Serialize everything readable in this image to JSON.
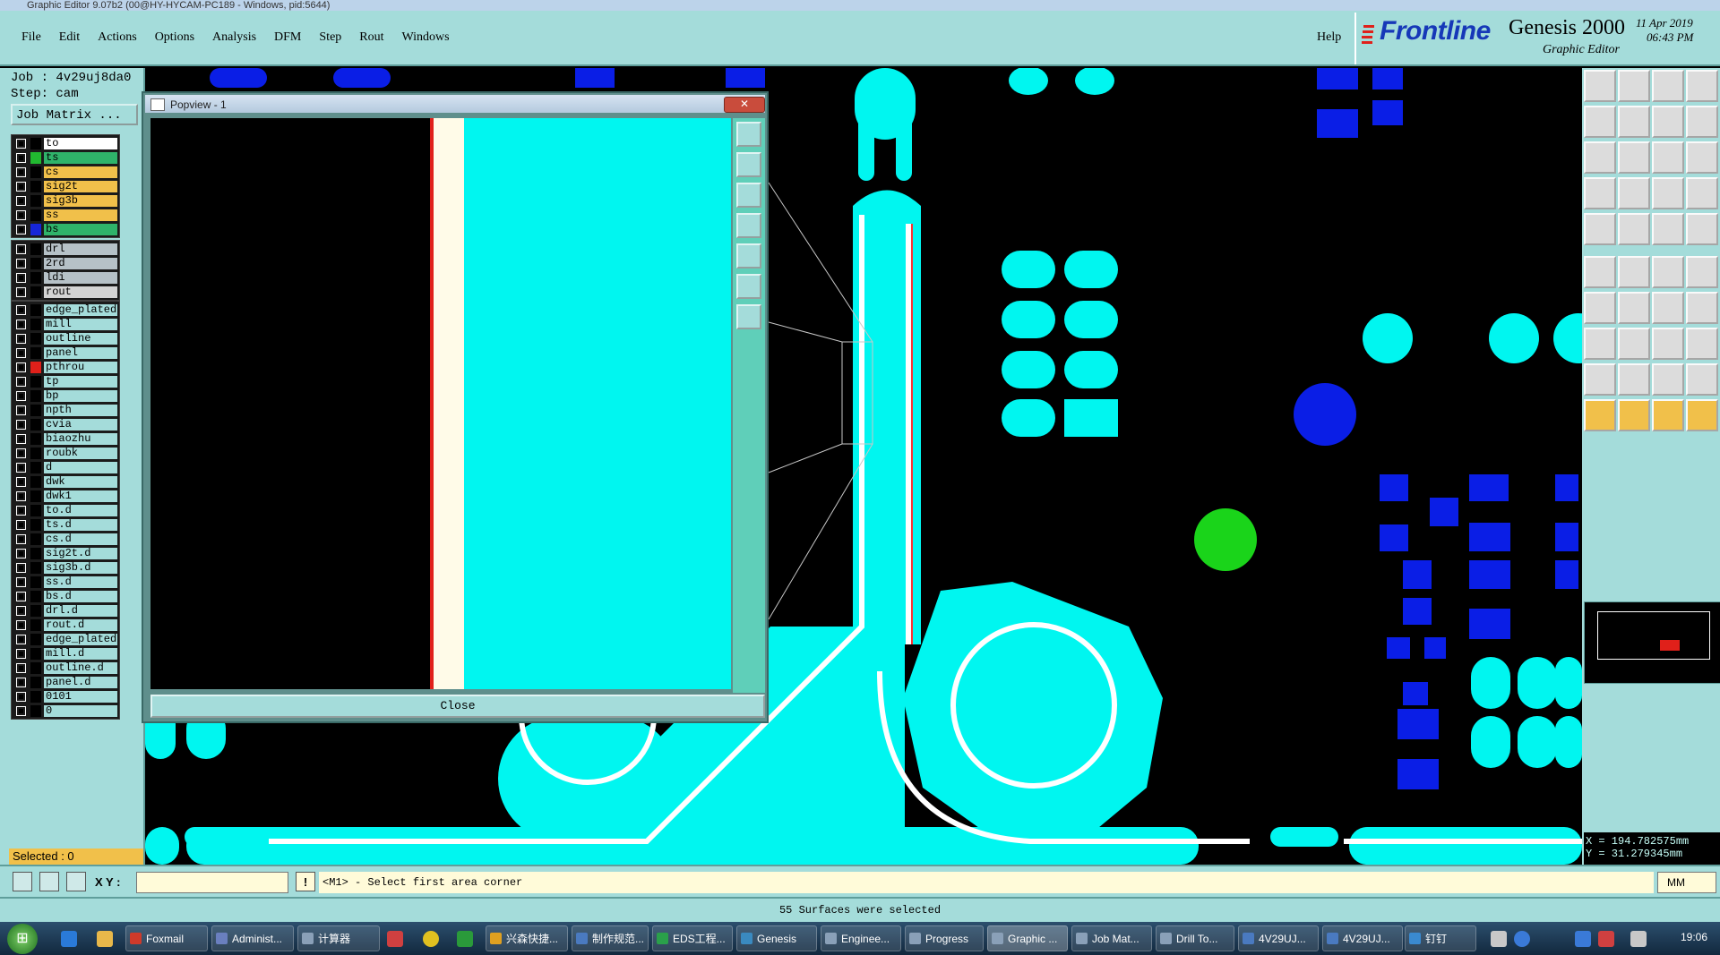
{
  "window": {
    "title": "Graphic Editor 9.07b2 (00@HY-HYCAM-PC189 - Windows, pid:5644)"
  },
  "menu": {
    "items": [
      "File",
      "Edit",
      "Actions",
      "Options",
      "Analysis",
      "DFM",
      "Step",
      "Rout",
      "Windows"
    ],
    "help": "Help"
  },
  "brand": {
    "logo": "Frontline",
    "product": "Genesis 2000",
    "subtitle": "Graphic Editor",
    "date": "11 Apr 2019",
    "time": "06:43 PM",
    "accent": "#1638b8"
  },
  "job": {
    "job_line": "Job : 4v29uj8da0",
    "step_line": "Step: cam",
    "matrix_button": "Job Matrix ..."
  },
  "layers": {
    "group1": [
      {
        "name": "to",
        "color": "#000000",
        "bg": "#ffffff"
      },
      {
        "name": "ts",
        "color": "#21b930",
        "bg": "#2fb36a"
      },
      {
        "name": "cs",
        "color": "#000000",
        "bg": "#f1c04a"
      },
      {
        "name": "sig2t",
        "color": "#000000",
        "bg": "#f1c04a"
      },
      {
        "name": "sig3b",
        "color": "#000000",
        "bg": "#f1c04a"
      },
      {
        "name": "ss",
        "color": "#000000",
        "bg": "#f1c04a"
      },
      {
        "name": "bs",
        "color": "#1626d8",
        "bg": "#2fb36a"
      }
    ],
    "group2": [
      {
        "name": "drl",
        "color": "#000000",
        "bg": "#b6c1c7"
      },
      {
        "name": "2rd",
        "color": "#000000",
        "bg": "#b6c1c7"
      },
      {
        "name": "ldi",
        "color": "#000000",
        "bg": "#b6c1c7"
      },
      {
        "name": "rout",
        "color": "#000000",
        "bg": "#d4d4d4"
      }
    ],
    "group3": [
      {
        "name": "edge_plated",
        "color": "#000000",
        "bg": "#a4dcda"
      },
      {
        "name": "mill",
        "color": "#000000",
        "bg": "#a4dcda"
      },
      {
        "name": "outline",
        "color": "#000000",
        "bg": "#a4dcda"
      },
      {
        "name": "panel",
        "color": "#000000",
        "bg": "#a4dcda"
      },
      {
        "name": "pthrou",
        "color": "#e0201a",
        "bg": "#a4dcda"
      },
      {
        "name": "tp",
        "color": "#000000",
        "bg": "#a4dcda"
      },
      {
        "name": "bp",
        "color": "#000000",
        "bg": "#a4dcda"
      },
      {
        "name": "npth",
        "color": "#000000",
        "bg": "#a4dcda"
      },
      {
        "name": "cvia",
        "color": "#000000",
        "bg": "#a4dcda"
      },
      {
        "name": "biaozhu",
        "color": "#000000",
        "bg": "#a4dcda"
      },
      {
        "name": "roubk",
        "color": "#000000",
        "bg": "#a4dcda"
      },
      {
        "name": "d",
        "color": "#000000",
        "bg": "#a4dcda"
      },
      {
        "name": "dwk",
        "color": "#000000",
        "bg": "#a4dcda"
      },
      {
        "name": "dwk1",
        "color": "#000000",
        "bg": "#a4dcda"
      },
      {
        "name": "to.d",
        "color": "#000000",
        "bg": "#a4dcda"
      },
      {
        "name": "ts.d",
        "color": "#000000",
        "bg": "#a4dcda"
      },
      {
        "name": "cs.d",
        "color": "#000000",
        "bg": "#a4dcda"
      },
      {
        "name": "sig2t.d",
        "color": "#000000",
        "bg": "#a4dcda"
      },
      {
        "name": "sig3b.d",
        "color": "#000000",
        "bg": "#a4dcda"
      },
      {
        "name": "ss.d",
        "color": "#000000",
        "bg": "#a4dcda"
      },
      {
        "name": "bs.d",
        "color": "#000000",
        "bg": "#a4dcda"
      },
      {
        "name": "drl.d",
        "color": "#000000",
        "bg": "#a4dcda"
      },
      {
        "name": "rout.d",
        "color": "#000000",
        "bg": "#a4dcda"
      },
      {
        "name": "edge_plated",
        "color": "#000000",
        "bg": "#a4dcda"
      },
      {
        "name": "mill.d",
        "color": "#000000",
        "bg": "#a4dcda"
      },
      {
        "name": "outline.d",
        "color": "#000000",
        "bg": "#a4dcda"
      },
      {
        "name": "panel.d",
        "color": "#000000",
        "bg": "#a4dcda"
      },
      {
        "name": "0101",
        "color": "#000000",
        "bg": "#a4dcda"
      },
      {
        "name": "0",
        "color": "#000000",
        "bg": "#a4dcda"
      }
    ]
  },
  "selected": "Selected : 0",
  "popview": {
    "title": "Popview - 1",
    "close_label": "Close"
  },
  "coords": {
    "x": "X = 194.782575mm",
    "y": "Y = 31.279345mm"
  },
  "command": {
    "xy_label": "X Y :",
    "bang": "!",
    "prompt": "<M1> - Select first area corner",
    "units": "MM"
  },
  "status": "55 Surfaces were selected",
  "taskbar": {
    "items": [
      {
        "label": "Foxmail",
        "color": "#d03a2a"
      },
      {
        "label": "Administ...",
        "color": "#6a7fbf"
      },
      {
        "label": "计算器",
        "color": "#8aa0b8"
      },
      {
        "label": "兴森快捷...",
        "color": "#e0a020"
      },
      {
        "label": "制作规范...",
        "color": "#4a7ac0"
      },
      {
        "label": "EDS工程...",
        "color": "#2aa04a"
      },
      {
        "label": "Genesis",
        "color": "#3a8ac0"
      },
      {
        "label": "Enginee...",
        "color": "#8aa0b8"
      },
      {
        "label": "Progress",
        "color": "#8aa0b8"
      },
      {
        "label": "Graphic ...",
        "color": "#8aa0b8"
      },
      {
        "label": "Job Mat...",
        "color": "#8aa0b8"
      },
      {
        "label": "Drill To...",
        "color": "#8aa0b8"
      },
      {
        "label": "4V29UJ...",
        "color": "#4a7ac0"
      },
      {
        "label": "4V29UJ...",
        "color": "#4a7ac0"
      },
      {
        "label": "钉钉",
        "color": "#3a8ad0"
      }
    ],
    "clock": "19:06"
  },
  "colors": {
    "ui_bg": "#a4dcda",
    "copper": "#00f6f0",
    "pad_blue": "#0a1ee6",
    "highlight_green": "#1ad41a"
  }
}
